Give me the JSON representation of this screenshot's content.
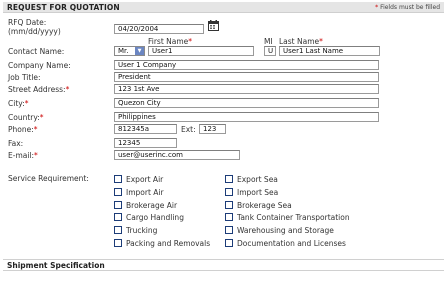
{
  "header": {
    "title": "REQUEST FOR QUOTATION",
    "required_star": "*",
    "required_note": "Fields must be filled"
  },
  "form": {
    "rfq_date": {
      "label_line1": "RFQ Date:",
      "label_line2": "(mm/dd/yyyy)",
      "value": "04/20/2004"
    },
    "contact": {
      "label": "Contact Name:",
      "first_name_header": "First Name",
      "mi_header": "MI",
      "last_name_header": "Last Name",
      "salutation": "Mr.",
      "first_name": "User1",
      "mi": "U",
      "last_name": "User1 Last Name"
    },
    "company": {
      "label": "Company Name:",
      "value": "User 1 Company"
    },
    "job_title": {
      "label": "Job Title:",
      "value": "President"
    },
    "street": {
      "label": "Street Address:",
      "value": "123 1st Ave"
    },
    "city": {
      "label": "City:",
      "value": "Quezon City"
    },
    "country": {
      "label": "Country:",
      "value": "Philippines"
    },
    "phone": {
      "label": "Phone:",
      "value": "812345a",
      "ext_label": "Ext:",
      "ext_value": "123"
    },
    "fax": {
      "label": "Fax:",
      "value": "12345"
    },
    "email": {
      "label": "E-mail:",
      "value": "user@userinc.com"
    },
    "service": {
      "label": "Service Requirement:",
      "left": [
        "Export Air",
        "Import Air",
        "Brokerage Air",
        "Cargo Handling",
        "Trucking",
        "Packing and Removals"
      ],
      "right": [
        "Export Sea",
        "Import Sea",
        "Brokerage Sea",
        "Tank Container Transportation",
        "Warehousing and Storage",
        "Documentation and Licenses"
      ]
    }
  },
  "shipment": {
    "title": "Shipment Specification"
  },
  "colors": {
    "required": "#cc0000",
    "header_bg": "#e5e5e5",
    "checkbox_border": "#1c3c78",
    "select_arrow": "#6b86c2"
  },
  "icons": {
    "calendar": "calendar-icon",
    "dropdown": "chevron-down-icon"
  }
}
